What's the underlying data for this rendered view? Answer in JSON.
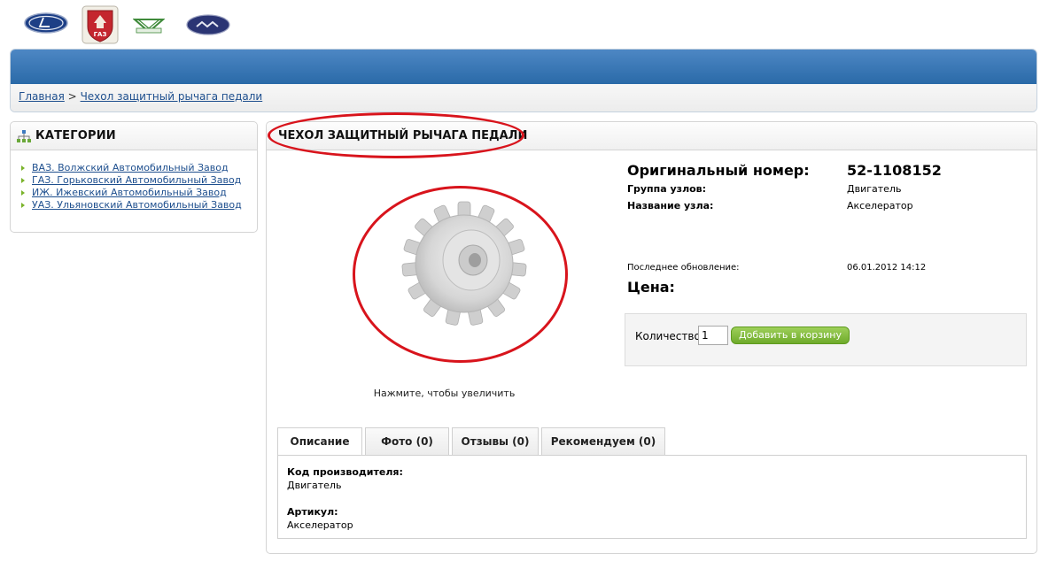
{
  "logos": [
    {
      "name": "vaz-logo"
    },
    {
      "name": "gaz-logo",
      "text": "ГАЗ"
    },
    {
      "name": "uaz-logo"
    },
    {
      "name": "izh-logo"
    }
  ],
  "colors": {
    "header_blue": "#3a78b8",
    "link": "#1e4f8e",
    "highlight_oval": "#d8141c",
    "button_green": "#7cb637"
  },
  "breadcrumb": {
    "home": "Главная",
    "separator": ">",
    "current": "Чехол защитный рычага педали"
  },
  "sidebar": {
    "title": "КАТЕГОРИИ",
    "icon": "sitemap-icon",
    "items": [
      "ВАЗ. Волжский Автомобильный Завод",
      "ГАЗ. Горьковский Автомобильный Завод",
      "ИЖ. Ижевский Автомобильный Завод",
      "УАЗ. Ульяновский Автомобильный Завод"
    ]
  },
  "product": {
    "title": "ЧЕХОЛ ЗАЩИТНЫЙ РЫЧАГА ПЕДАЛИ",
    "image_hint": "Нажмите, чтобы увеличить",
    "original_number_label": "Оригинальный номер:",
    "original_number": "52-1108152",
    "group_label": "Группа узлов:",
    "group": "Двигатель",
    "unit_label": "Название узла:",
    "unit": "Акселератор",
    "updated_label": "Последнее обновление:",
    "updated": "06.01.2012 14:12",
    "price_label": "Цена:"
  },
  "cart": {
    "qty_label": "Количество:",
    "qty_value": "1",
    "add_button": "Добавить в корзину"
  },
  "tabs": [
    {
      "label": "Описание"
    },
    {
      "label": "Фото (0)"
    },
    {
      "label": "Отзывы (0)"
    },
    {
      "label": "Рекомендуем (0)"
    }
  ],
  "description": {
    "maker_code_label": "Код производителя:",
    "maker_code": "Двигатель",
    "article_label": "Артикул:",
    "article": "Акселератор"
  }
}
